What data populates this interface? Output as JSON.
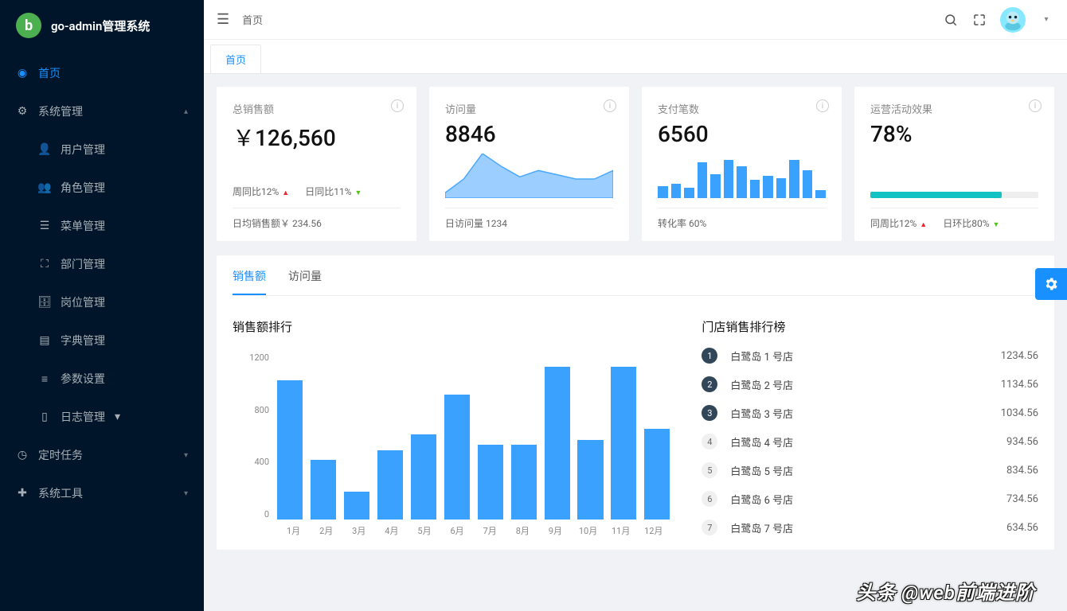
{
  "brand": "go-admin管理系统",
  "topbar": {
    "breadcrumb": "首页"
  },
  "tabs": {
    "home": "首页"
  },
  "sidebar": {
    "items": [
      {
        "icon": "dashboard",
        "label": "首页",
        "active": true,
        "expandable": false
      },
      {
        "icon": "gear",
        "label": "系统管理",
        "expandable": true,
        "expanded": true,
        "children": [
          {
            "icon": "user",
            "label": "用户管理"
          },
          {
            "icon": "users",
            "label": "角色管理"
          },
          {
            "icon": "list",
            "label": "菜单管理"
          },
          {
            "icon": "sitemap",
            "label": "部门管理"
          },
          {
            "icon": "id",
            "label": "岗位管理"
          },
          {
            "icon": "book",
            "label": "字典管理"
          },
          {
            "icon": "sliders",
            "label": "参数设置"
          },
          {
            "icon": "file",
            "label": "日志管理",
            "expandable": true
          }
        ]
      },
      {
        "icon": "clock",
        "label": "定时任务",
        "expandable": true
      },
      {
        "icon": "tools",
        "label": "系统工具",
        "expandable": true
      }
    ]
  },
  "stats": {
    "sales": {
      "title": "总销售额",
      "value": "￥126,560",
      "wow_label": "周同比12%",
      "dod_label": "日同比11%",
      "footer_label": "日均销售额￥ 234.56"
    },
    "visits": {
      "title": "访问量",
      "value": "8846",
      "footer_label": "日访问量 1234"
    },
    "payments": {
      "title": "支付笔数",
      "value": "6560",
      "footer_label": "转化率 60%"
    },
    "ops": {
      "title": "运营活动效果",
      "value": "78%",
      "progress": 78,
      "wow_label": "同周比12%",
      "dod_label": "日环比80%"
    }
  },
  "panel": {
    "tabs": {
      "sales": "销售额",
      "visits": "访问量"
    },
    "left_title": "销售额排行",
    "right_title": "门店销售排行榜",
    "ranking": [
      {
        "n": "1",
        "name": "白鹭岛 1 号店",
        "value": "1234.56"
      },
      {
        "n": "2",
        "name": "白鹭岛 2 号店",
        "value": "1134.56"
      },
      {
        "n": "3",
        "name": "白鹭岛 3 号店",
        "value": "1034.56"
      },
      {
        "n": "4",
        "name": "白鹭岛 4 号店",
        "value": "934.56"
      },
      {
        "n": "5",
        "name": "白鹭岛 5 号店",
        "value": "834.56"
      },
      {
        "n": "6",
        "name": "白鹭岛 6 号店",
        "value": "734.56"
      },
      {
        "n": "7",
        "name": "白鹭岛 7 号店",
        "value": "634.56"
      }
    ]
  },
  "chart_data": [
    {
      "type": "area",
      "name": "visits-sparkline",
      "x": [
        0,
        1,
        2,
        3,
        4,
        5,
        6,
        7,
        8,
        9
      ],
      "values": [
        5,
        18,
        42,
        30,
        20,
        26,
        22,
        18,
        18,
        26
      ]
    },
    {
      "type": "bar",
      "name": "payments-sparkline",
      "x": [
        1,
        2,
        3,
        4,
        5,
        6,
        7,
        8,
        9,
        10,
        11,
        12,
        13
      ],
      "values": [
        30,
        35,
        25,
        90,
        60,
        95,
        80,
        45,
        55,
        50,
        95,
        70,
        20
      ]
    },
    {
      "type": "bar",
      "name": "monthly-sales",
      "title": "销售额排行",
      "categories": [
        "1月",
        "2月",
        "3月",
        "4月",
        "5月",
        "6月",
        "7月",
        "8月",
        "9月",
        "10月",
        "11月",
        "12月"
      ],
      "values": [
        1000,
        430,
        200,
        500,
        610,
        900,
        540,
        540,
        1100,
        570,
        1100,
        650
      ],
      "ylabel": "",
      "xlabel": "",
      "ylim": [
        0,
        1200
      ],
      "yticks": [
        0,
        400,
        800,
        1200
      ]
    }
  ],
  "watermark": "头条 @web前端进阶"
}
